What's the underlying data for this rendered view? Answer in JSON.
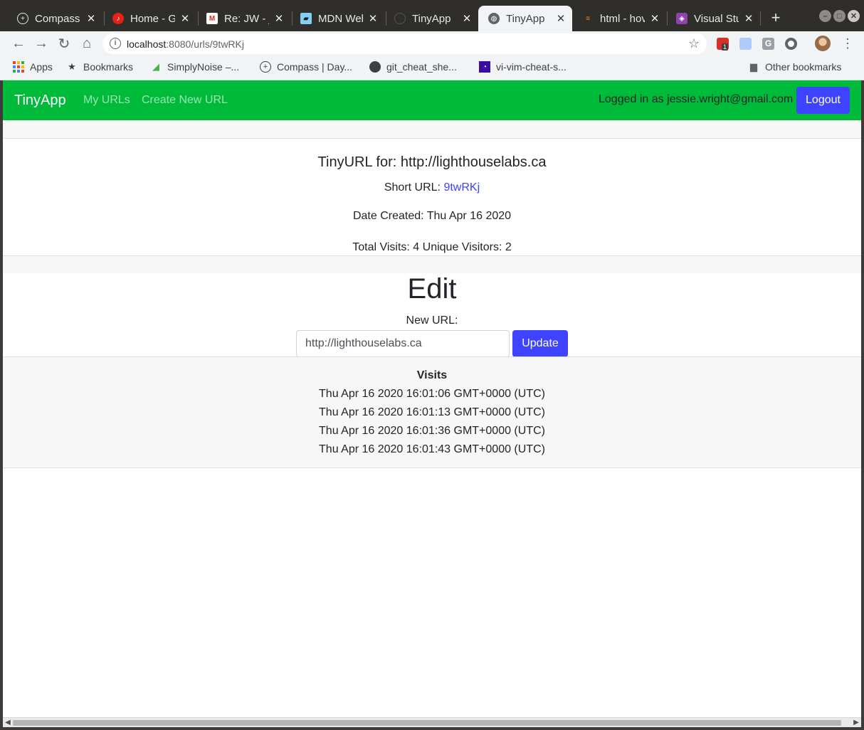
{
  "browser": {
    "tabs": [
      {
        "label": "Compass |",
        "icon": "compass-icon",
        "active": false
      },
      {
        "label": "Home - Go",
        "icon": "music-icon",
        "active": false
      },
      {
        "label": "Re: JW - je",
        "icon": "gmail-icon",
        "active": false
      },
      {
        "label": "MDN Web",
        "icon": "mdn-icon",
        "active": false
      },
      {
        "label": "TinyApp",
        "icon": "github-icon",
        "active": false
      },
      {
        "label": "TinyApp",
        "icon": "globe-icon",
        "active": true
      },
      {
        "label": "html - hov",
        "icon": "stackoverflow-icon",
        "active": false
      },
      {
        "label": "Visual Stu",
        "icon": "vscode-icon",
        "active": false
      }
    ],
    "url_host": "localhost",
    "url_rest": ":8080/urls/9twRKj",
    "extension_badge": "1",
    "bookmarks": [
      {
        "label": "Apps",
        "icon": "apps-grid-icon"
      },
      {
        "label": "Bookmarks",
        "icon": "star-icon"
      },
      {
        "label": "SimplyNoise –...",
        "icon": "speaker-icon"
      },
      {
        "label": "Compass | Day...",
        "icon": "compass-icon"
      },
      {
        "label": "git_cheat_she...",
        "icon": "github-icon"
      },
      {
        "label": "vi-vim-cheat-s...",
        "icon": "vim-icon"
      }
    ],
    "other_bookmarks": "Other bookmarks"
  },
  "nav": {
    "brand": "TinyApp",
    "my_urls": "My URLs",
    "create_new": "Create New URL",
    "logged_in": "Logged in as jessie.wright@gmail.com",
    "logout": "Logout"
  },
  "card": {
    "title": "TinyURL for: http://lighthouselabs.ca",
    "short_label": "Short URL: ",
    "short_value": "9twRKj",
    "date_created": "Date Created: Thu Apr 16 2020",
    "visits_summary": "Total Visits: 4 Unique Visitors: 2"
  },
  "edit": {
    "title": "Edit",
    "label": "New URL:",
    "input_value": "http://lighthouselabs.ca",
    "update_button": "Update"
  },
  "visits": {
    "heading": "Visits",
    "rows": [
      "Thu Apr 16 2020 16:01:06 GMT+0000 (UTC)",
      "Thu Apr 16 2020 16:01:13 GMT+0000 (UTC)",
      "Thu Apr 16 2020 16:01:36 GMT+0000 (UTC)",
      "Thu Apr 16 2020 16:01:43 GMT+0000 (UTC)"
    ]
  },
  "colors": {
    "navbar": "#00ba3a",
    "primary_button": "#3d43ff",
    "link": "#3d43ff"
  }
}
